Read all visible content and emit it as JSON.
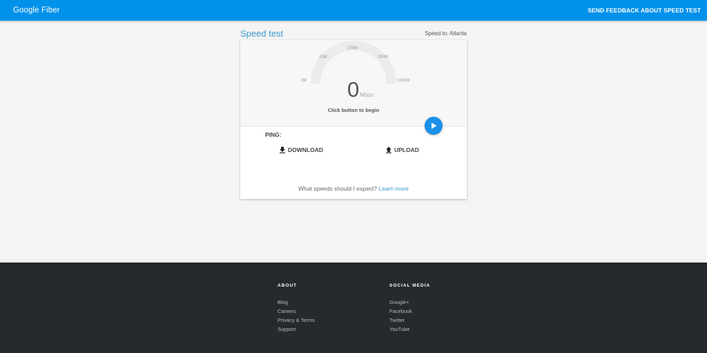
{
  "header": {
    "brand": "Google Fiber",
    "feedback_label": "SEND FEEDBACK ABOUT SPEED TEST",
    "color": "#0091ea"
  },
  "main": {
    "title": "Speed test",
    "speed_to": "Speed to: Atlanta",
    "gauge": {
      "ticks": [
        "0M",
        "25M",
        "100M",
        "250M",
        "1000M"
      ],
      "value": "0",
      "unit": "Mbps",
      "status": "Click button to begin"
    },
    "play_icon": "play-icon",
    "ping_label": "PING:",
    "download_label": "DOWNLOAD",
    "download_icon": "download-icon",
    "upload_label": "UPLOAD",
    "upload_icon": "upload-icon",
    "expect_text": "What speeds should I expect?",
    "learn_more": "Learn more"
  },
  "footer": {
    "about": {
      "heading": "ABOUT",
      "links": [
        "Blog",
        "Careers",
        "Privacy & Terms",
        "Support"
      ]
    },
    "social": {
      "heading": "SOCIAL MEDIA",
      "links": [
        "Google+",
        "Facebook",
        "Twitter",
        "YouTube"
      ]
    }
  }
}
